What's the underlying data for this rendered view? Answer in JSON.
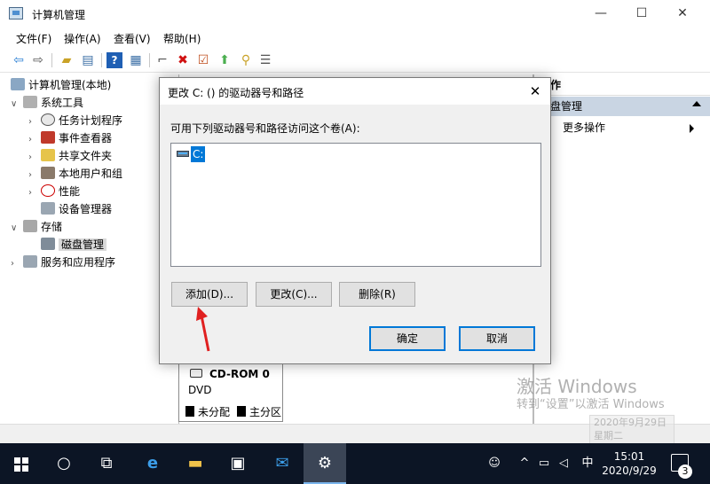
{
  "window": {
    "title": "计算机管理",
    "controls": {
      "minimize": "—",
      "maximize": "☐",
      "close": "✕"
    }
  },
  "menu": [
    "文件(F)",
    "操作(A)",
    "查看(V)",
    "帮助(H)"
  ],
  "toolbar_icons": [
    "back-icon",
    "forward-icon",
    "up-folder-icon",
    "show-hide-tree-icon",
    "help-icon",
    "properties-icon",
    "connect-icon",
    "delete-icon",
    "check-icon",
    "import-icon",
    "search-icon",
    "list-icon"
  ],
  "tree": {
    "root": "计算机管理(本地)",
    "system_tools": "系统工具",
    "task_scheduler": "任务计划程序",
    "event_viewer": "事件查看器",
    "shared_folders": "共享文件夹",
    "local_users_groups": "本地用户和组",
    "performance": "性能",
    "device_manager": "设备管理器",
    "storage": "存储",
    "disk_management": "磁盘管理",
    "services_apps": "服务和应用程序"
  },
  "content": {
    "cdrom_name": "CD-ROM 0",
    "cdrom_type": "DVD",
    "legend_unallocated": "未分配",
    "legend_primary": "主分区"
  },
  "actions": {
    "header": "作",
    "section": "盘管理",
    "more": "更多操作"
  },
  "dialog": {
    "title": "更改 C: () 的驱动器号和路径",
    "description": "可用下列驱动器号和路径访问这个卷(A):",
    "list_items": [
      "C:"
    ],
    "add_button": "添加(D)...",
    "change_button": "更改(C)...",
    "remove_button": "删除(R)",
    "ok_button": "确定",
    "cancel_button": "取消",
    "close_glyph": "✕"
  },
  "watermark": {
    "line1": "激活 Windows",
    "line2": "转到“设置”以激活 Windows",
    "ghost_date": "2020年9月29日",
    "ghost_day": "星期二"
  },
  "taskbar": {
    "time": "15:01",
    "date": "2020/9/29",
    "ime": "中",
    "notification_count": "3",
    "apps": [
      "search-icon",
      "task-view-icon",
      "edge-icon",
      "file-explorer-icon",
      "store-icon",
      "mail-icon",
      "computer-management-icon"
    ]
  },
  "colors": {
    "selection": "#0078d7",
    "actions_section_bg": "#c9d5e3",
    "taskbar_bg": "#0c1525",
    "annotation_arrow": "#e02020"
  }
}
